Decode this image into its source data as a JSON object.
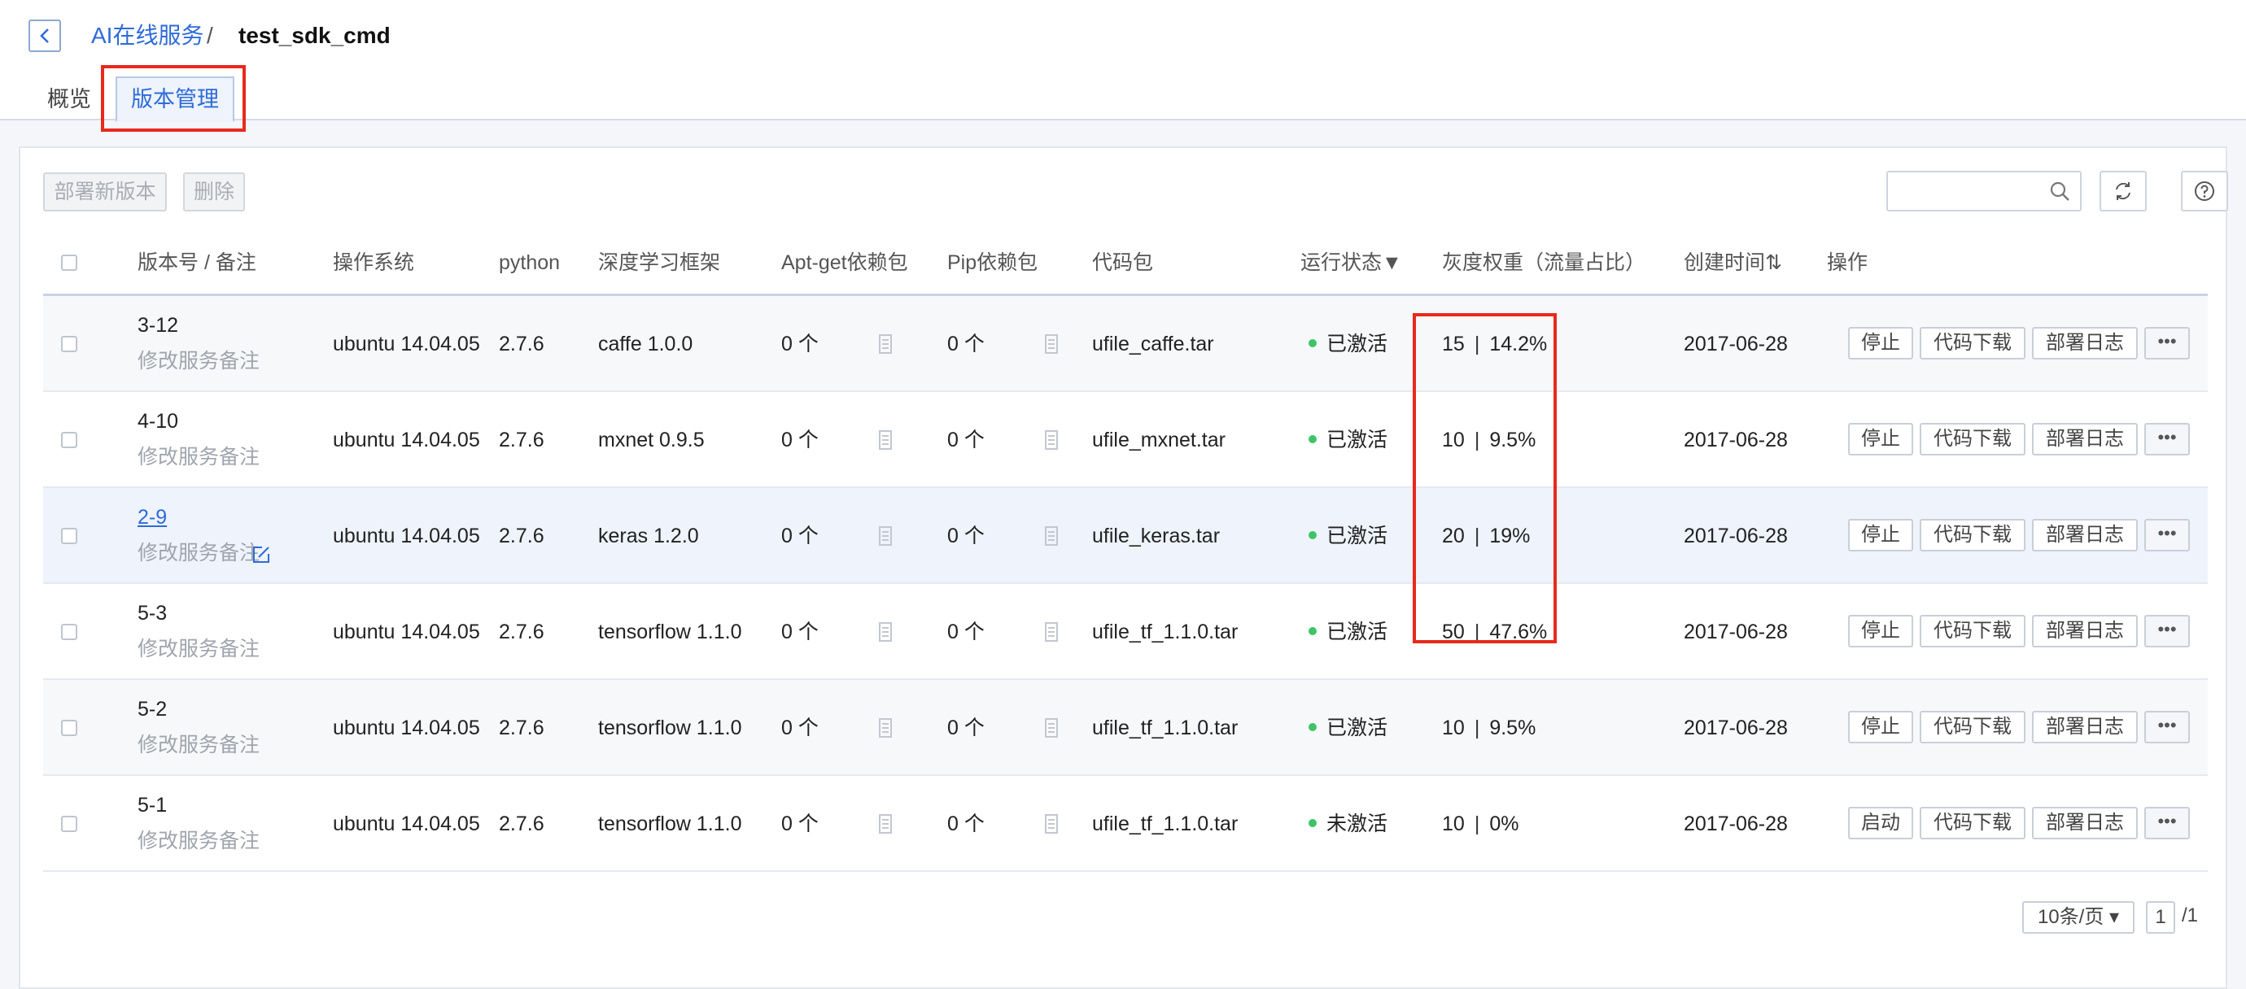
{
  "breadcrumb": {
    "parent": "AI在线服务",
    "separator": "/",
    "current": "test_sdk_cmd"
  },
  "tabs": [
    {
      "label": "概览"
    },
    {
      "label": "版本管理"
    }
  ],
  "toolbar": {
    "deploy_label": "部署新版本",
    "delete_label": "删除",
    "search_placeholder": ""
  },
  "table": {
    "headers": {
      "version": "版本号 / 备注",
      "os": "操作系统",
      "python": "python",
      "framework": "深度学习框架",
      "apt": "Apt-get依赖包",
      "pip": "Pip依赖包",
      "code": "代码包",
      "status": "运行状态▼",
      "weight": "灰度权重（流量占比）",
      "created": "创建时间⇅",
      "actions": "操作"
    },
    "rows": [
      {
        "version": "3-12",
        "note": "修改服务备注",
        "os": "ubuntu 14.04.05",
        "python": "2.7.6",
        "framework": "caffe 1.0.0",
        "apt": "0 个",
        "pip": "0 个",
        "code": "ufile_caffe.tar",
        "status": "已激活",
        "weight": "15",
        "ratio": "14.2%",
        "created": "2017-06-28",
        "toggle": "停止",
        "download": "代码下载",
        "log": "部署日志",
        "more": "•••"
      },
      {
        "version": "4-10",
        "note": "修改服务备注",
        "os": "ubuntu 14.04.05",
        "python": "2.7.6",
        "framework": "mxnet 0.9.5",
        "apt": "0 个",
        "pip": "0 个",
        "code": "ufile_mxnet.tar",
        "status": "已激活",
        "weight": "10",
        "ratio": "9.5%",
        "created": "2017-06-28",
        "toggle": "停止",
        "download": "代码下载",
        "log": "部署日志",
        "more": "•••"
      },
      {
        "version": "2-9",
        "note": "修改服务备注",
        "os": "ubuntu 14.04.05",
        "python": "2.7.6",
        "framework": "keras 1.2.0",
        "apt": "0 个",
        "pip": "0 个",
        "code": "ufile_keras.tar",
        "status": "已激活",
        "weight": "20",
        "ratio": "19%",
        "created": "2017-06-28",
        "toggle": "停止",
        "download": "代码下载",
        "log": "部署日志",
        "more": "•••"
      },
      {
        "version": "5-3",
        "note": "修改服务备注",
        "os": "ubuntu 14.04.05",
        "python": "2.7.6",
        "framework": "tensorflow 1.1.0",
        "apt": "0 个",
        "pip": "0 个",
        "code": "ufile_tf_1.1.0.tar",
        "status": "已激活",
        "weight": "50",
        "ratio": "47.6%",
        "created": "2017-06-28",
        "toggle": "停止",
        "download": "代码下载",
        "log": "部署日志",
        "more": "•••"
      },
      {
        "version": "5-2",
        "note": "修改服务备注",
        "os": "ubuntu 14.04.05",
        "python": "2.7.6",
        "framework": "tensorflow 1.1.0",
        "apt": "0 个",
        "pip": "0 个",
        "code": "ufile_tf_1.1.0.tar",
        "status": "已激活",
        "weight": "10",
        "ratio": "9.5%",
        "created": "2017-06-28",
        "toggle": "停止",
        "download": "代码下载",
        "log": "部署日志",
        "more": "•••"
      },
      {
        "version": "5-1",
        "note": "修改服务备注",
        "os": "ubuntu 14.04.05",
        "python": "2.7.6",
        "framework": "tensorflow 1.1.0",
        "apt": "0 个",
        "pip": "0 个",
        "code": "ufile_tf_1.1.0.tar",
        "status": "未激活",
        "weight": "10",
        "ratio": "0%",
        "created": "2017-06-28",
        "toggle": "启动",
        "download": "代码下载",
        "log": "部署日志",
        "more": "•••"
      }
    ]
  },
  "pagination": {
    "page_size": "10条/页 ▾",
    "current": "1",
    "total": "/1"
  },
  "colors": {
    "accent": "#2f6bd8",
    "highlight": "#e8291c",
    "active_dot": "#3ec467"
  },
  "icons": [
    "back-icon",
    "search-icon",
    "refresh-icon",
    "help-icon",
    "edit-icon",
    "document-icon"
  ]
}
